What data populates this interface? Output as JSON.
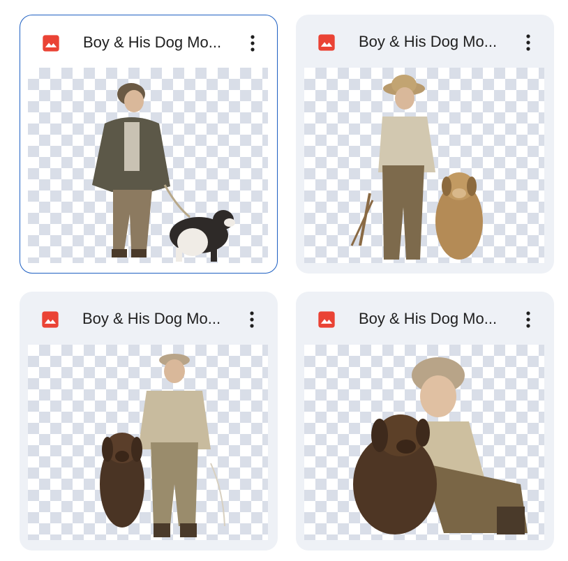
{
  "files": [
    {
      "title": "Boy & His Dog Mo...",
      "selected": true,
      "icon": "image-file-icon"
    },
    {
      "title": "Boy & His Dog Mo...",
      "selected": false,
      "icon": "image-file-icon"
    },
    {
      "title": "Boy & His Dog Mo...",
      "selected": false,
      "icon": "image-file-icon"
    },
    {
      "title": "Boy & His Dog Mo...",
      "selected": false,
      "icon": "image-file-icon"
    }
  ],
  "colors": {
    "icon_red": "#ea4335",
    "selection_border": "#1d5fc2",
    "card_bg": "#eef1f6"
  }
}
